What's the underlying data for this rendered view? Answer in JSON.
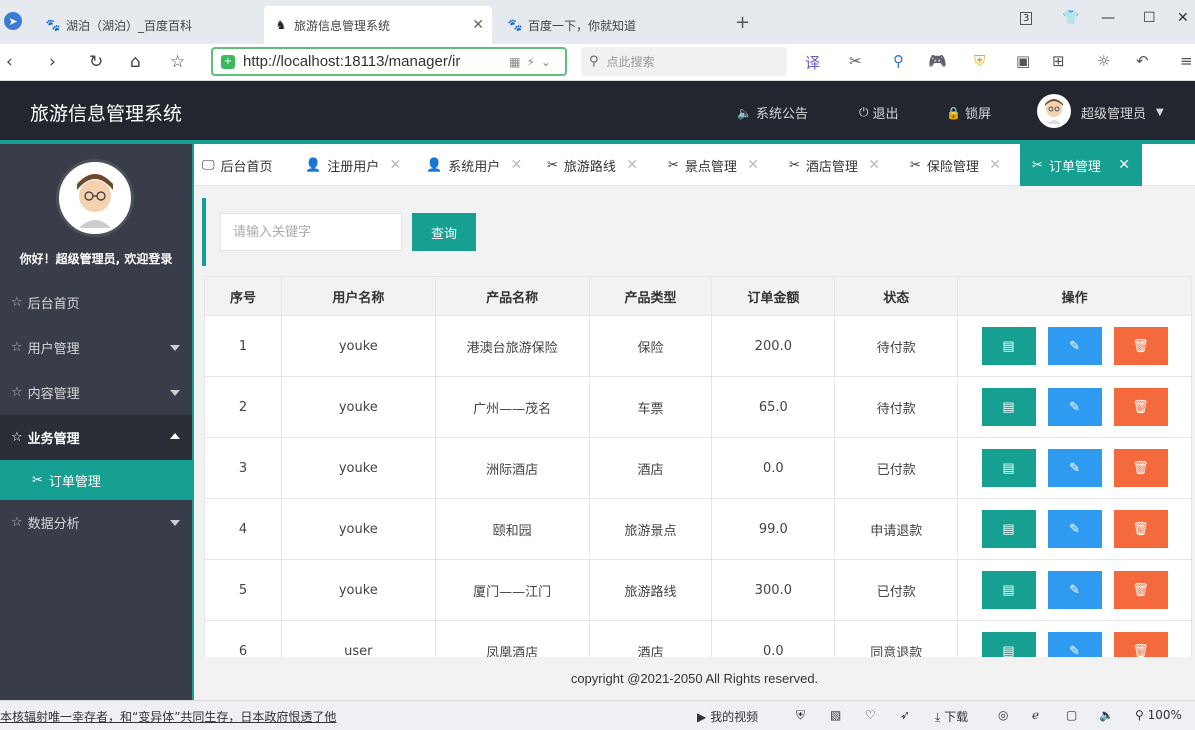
{
  "browser": {
    "tabs": [
      {
        "title": "湖泊（湖泊）_百度百科",
        "icon": "baidu-paw-icon"
      },
      {
        "title": "旅游信息管理系统",
        "icon": "horse-icon"
      },
      {
        "title": "百度一下，你就知道",
        "icon": "baidu-paw-icon"
      }
    ],
    "tab_count": "3",
    "url": "http://localhost:18113/manager/ir",
    "search_placeholder": "点此搜索"
  },
  "header": {
    "logo": "旅游信息管理系统",
    "notice": "系统公告",
    "logout": "退出",
    "lock": "锁屏",
    "user": "超级管理员"
  },
  "sidebar": {
    "welcome": "你好！超级管理员, 欢迎登录",
    "items": [
      {
        "label": "后台首页"
      },
      {
        "label": "用户管理"
      },
      {
        "label": "内容管理"
      },
      {
        "label": "业务管理"
      },
      {
        "label": "数据分析"
      }
    ],
    "sub_active": "订单管理"
  },
  "tabs": [
    {
      "label": "后台首页"
    },
    {
      "label": "注册用户"
    },
    {
      "label": "系统用户"
    },
    {
      "label": "旅游路线"
    },
    {
      "label": "景点管理"
    },
    {
      "label": "酒店管理"
    },
    {
      "label": "保险管理"
    },
    {
      "label": "订单管理"
    }
  ],
  "search": {
    "placeholder": "请输入关键字",
    "button": "查询"
  },
  "table": {
    "headers": [
      "序号",
      "用户名称",
      "产品名称",
      "产品类型",
      "订单金额",
      "状态",
      "操作"
    ],
    "rows": [
      {
        "no": "1",
        "user": "youke",
        "product": "港澳台旅游保险",
        "type": "保险",
        "amount": "200.0",
        "status": "待付款"
      },
      {
        "no": "2",
        "user": "youke",
        "product": "广州——茂名",
        "type": "车票",
        "amount": "65.0",
        "status": "待付款"
      },
      {
        "no": "3",
        "user": "youke",
        "product": "洲际酒店",
        "type": "酒店",
        "amount": "0.0",
        "status": "已付款"
      },
      {
        "no": "4",
        "user": "youke",
        "product": "颐和园",
        "type": "旅游景点",
        "amount": "99.0",
        "status": "申请退款"
      },
      {
        "no": "5",
        "user": "youke",
        "product": "厦门——江门",
        "type": "旅游路线",
        "amount": "300.0",
        "status": "已付款"
      },
      {
        "no": "6",
        "user": "user",
        "product": "凤凰酒店",
        "type": "酒店",
        "amount": "0.0",
        "status": "同意退款"
      }
    ]
  },
  "footer": "copyright @2021-2050 All Rights reserved.",
  "statusbar": {
    "news": "本核辐射唯一幸存者，和“变异体”共同生存，日本政府恨透了他",
    "video": "我的视频",
    "download": "下载",
    "zoom": "100%"
  }
}
